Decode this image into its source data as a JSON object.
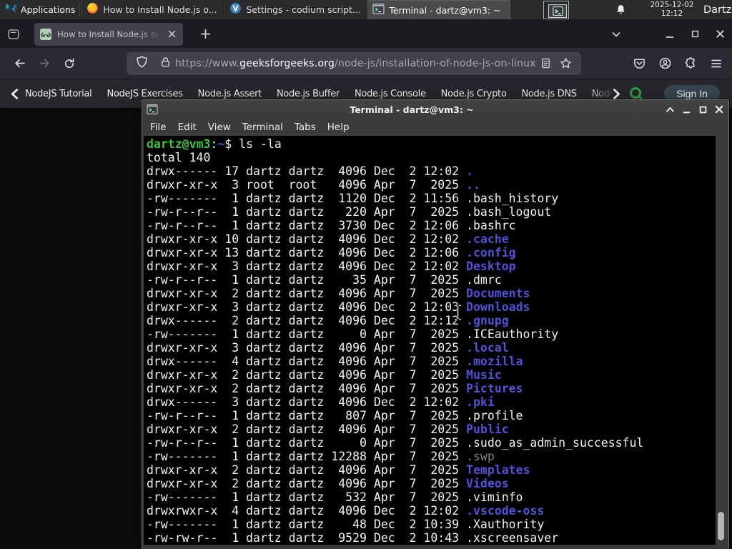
{
  "panel": {
    "applications_label": "Applications",
    "windows": [
      {
        "icon": "firefox-icon",
        "title": "How to Install Node.js o...",
        "active": false
      },
      {
        "icon": "codium-icon",
        "title": "Settings - codium script...",
        "active": false
      },
      {
        "icon": "terminal-icon",
        "title": "Terminal - dartz@vm3: ~",
        "active": true
      }
    ],
    "clock": {
      "date": "2025-12-02",
      "time": "12:12"
    },
    "username": "Dartz"
  },
  "browser": {
    "tab_title": "How to Install Node.js on",
    "url": {
      "scheme": "https://www.",
      "domain": "geeksforgeeks.org",
      "path": "/node-js/installation-of-node-js-on-linux/"
    }
  },
  "site_nav": {
    "links": [
      "NodeJS Tutorial",
      "NodeJS Exercises",
      "Node.js Assert",
      "Node.js Buffer",
      "Node.js Console",
      "Node.js Crypto",
      "Node.js DNS",
      "Node"
    ],
    "sign_in_label": "Sign In",
    "accent_green": "#2f9e4f"
  },
  "terminal": {
    "title": "Terminal - dartz@vm3: ~",
    "menu": [
      "File",
      "Edit",
      "View",
      "Terminal",
      "Tabs",
      "Help"
    ],
    "colors": {
      "background": "#000000",
      "foreground": "#f2f2f2",
      "prompt_green": "#3dc33d",
      "directory_blue": "#5252d6",
      "dim": "#7f7f7f"
    },
    "lines": [
      [
        {
          "t": "dartz@vm3",
          "c": "green"
        },
        {
          "t": ":",
          "c": "fg"
        },
        {
          "t": "~",
          "c": "blue"
        },
        {
          "t": "$ ls -la",
          "c": "fg"
        }
      ],
      [
        {
          "t": "total 140",
          "c": "fg"
        }
      ],
      [
        {
          "t": "drwx------ 17 dartz dartz  4096 Dec  2 12:02 ",
          "c": "fg"
        },
        {
          "t": ".",
          "c": "blue"
        }
      ],
      [
        {
          "t": "drwxr-xr-x  3 root  root   4096 Apr  7  2025 ",
          "c": "fg"
        },
        {
          "t": "..",
          "c": "blue"
        }
      ],
      [
        {
          "t": "-rw-------  1 dartz dartz  1120 Dec  2 11:56 .bash_history",
          "c": "fg"
        }
      ],
      [
        {
          "t": "-rw-r--r--  1 dartz dartz   220 Apr  7  2025 .bash_logout",
          "c": "fg"
        }
      ],
      [
        {
          "t": "-rw-r--r--  1 dartz dartz  3730 Dec  2 12:06 .bashrc",
          "c": "fg"
        }
      ],
      [
        {
          "t": "drwxr-xr-x 10 dartz dartz  4096 Dec  2 12:02 ",
          "c": "fg"
        },
        {
          "t": ".cache",
          "c": "blue"
        }
      ],
      [
        {
          "t": "drwxr-xr-x 13 dartz dartz  4096 Dec  2 12:06 ",
          "c": "fg"
        },
        {
          "t": ".config",
          "c": "blue"
        }
      ],
      [
        {
          "t": "drwxr-xr-x  3 dartz dartz  4096 Dec  2 12:02 ",
          "c": "fg"
        },
        {
          "t": "Desktop",
          "c": "blue"
        }
      ],
      [
        {
          "t": "-rw-r--r--  1 dartz dartz    35 Apr  7  2025 .dmrc",
          "c": "fg"
        }
      ],
      [
        {
          "t": "drwxr-xr-x  2 dartz dartz  4096 Apr  7  2025 ",
          "c": "fg"
        },
        {
          "t": "Documents",
          "c": "blue"
        }
      ],
      [
        {
          "t": "drwxr-xr-x  3 dartz dartz  4096 Dec  2 12:03 ",
          "c": "fg"
        },
        {
          "t": "Downloads",
          "c": "blue"
        }
      ],
      [
        {
          "t": "drwx------  2 dartz dartz  4096 Dec  2 12:12 ",
          "c": "fg"
        },
        {
          "t": ".gnupg",
          "c": "blue"
        }
      ],
      [
        {
          "t": "-rw-------  1 dartz dartz     0 Apr  7  2025 .ICEauthority",
          "c": "fg"
        }
      ],
      [
        {
          "t": "drwxr-xr-x  3 dartz dartz  4096 Apr  7  2025 ",
          "c": "fg"
        },
        {
          "t": ".local",
          "c": "blue"
        }
      ],
      [
        {
          "t": "drwx------  4 dartz dartz  4096 Apr  7  2025 ",
          "c": "fg"
        },
        {
          "t": ".mozilla",
          "c": "blue"
        }
      ],
      [
        {
          "t": "drwxr-xr-x  2 dartz dartz  4096 Apr  7  2025 ",
          "c": "fg"
        },
        {
          "t": "Music",
          "c": "blue"
        }
      ],
      [
        {
          "t": "drwxr-xr-x  2 dartz dartz  4096 Apr  7  2025 ",
          "c": "fg"
        },
        {
          "t": "Pictures",
          "c": "blue"
        }
      ],
      [
        {
          "t": "drwx------  3 dartz dartz  4096 Dec  2 12:02 ",
          "c": "fg"
        },
        {
          "t": ".pki",
          "c": "blue"
        }
      ],
      [
        {
          "t": "-rw-r--r--  1 dartz dartz   807 Apr  7  2025 .profile",
          "c": "fg"
        }
      ],
      [
        {
          "t": "drwxr-xr-x  2 dartz dartz  4096 Apr  7  2025 ",
          "c": "fg"
        },
        {
          "t": "Public",
          "c": "blue"
        }
      ],
      [
        {
          "t": "-rw-r--r--  1 dartz dartz     0 Apr  7  2025 .sudo_as_admin_successful",
          "c": "fg"
        }
      ],
      [
        {
          "t": "-rw-------  1 dartz dartz 12288 Apr  7  2025 ",
          "c": "fg"
        },
        {
          "t": ".swp",
          "c": "dim"
        }
      ],
      [
        {
          "t": "drwxr-xr-x  2 dartz dartz  4096 Apr  7  2025 ",
          "c": "fg"
        },
        {
          "t": "Templates",
          "c": "blue"
        }
      ],
      [
        {
          "t": "drwxr-xr-x  2 dartz dartz  4096 Apr  7  2025 ",
          "c": "fg"
        },
        {
          "t": "Videos",
          "c": "blue"
        }
      ],
      [
        {
          "t": "-rw-------  1 dartz dartz   532 Apr  7  2025 .viminfo",
          "c": "fg"
        }
      ],
      [
        {
          "t": "drwxrwxr-x  4 dartz dartz  4096 Dec  2 12:02 ",
          "c": "fg"
        },
        {
          "t": ".vscode-oss",
          "c": "blue"
        }
      ],
      [
        {
          "t": "-rw-------  1 dartz dartz    48 Dec  2 10:39 .Xauthority",
          "c": "fg"
        }
      ],
      [
        {
          "t": "-rw-rw-r--  1 dartz dartz  9529 Dec  2 10:43 .xscreensaver",
          "c": "fg"
        }
      ]
    ]
  }
}
